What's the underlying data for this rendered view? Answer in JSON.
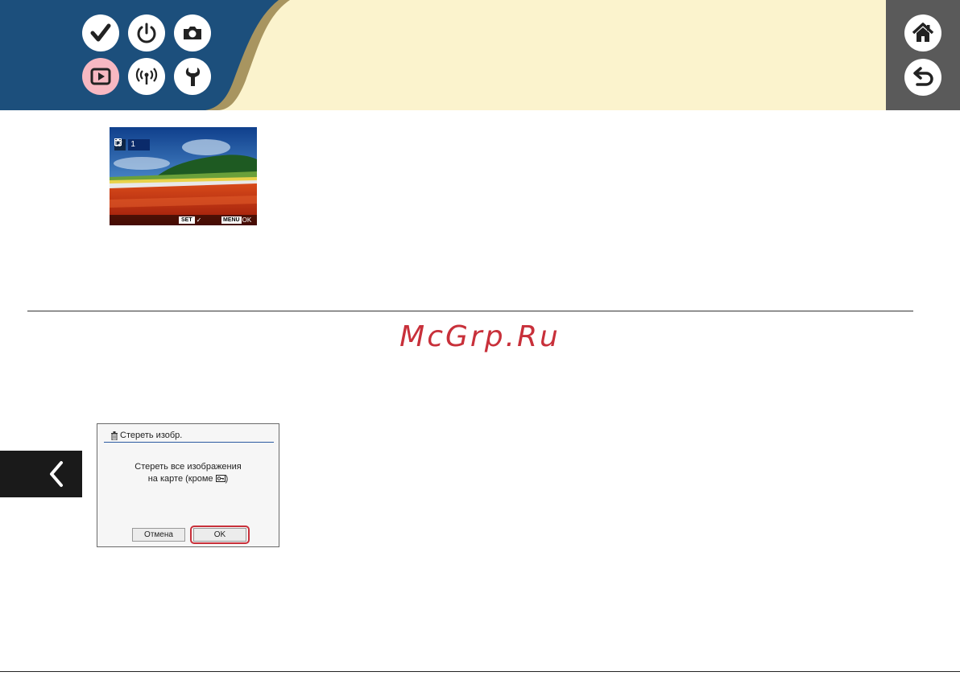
{
  "header": {
    "colors": {
      "dark_blue": "#1c4f7c",
      "gold_band": "#a89560",
      "cream": "#fbf3cd",
      "gray_sidebar": "#5a5a5a"
    },
    "nav_icons": [
      "checkmark-icon",
      "power-icon",
      "camera-icon",
      "playback-icon",
      "wireless-icon",
      "wrench-icon"
    ],
    "active_nav": "playback-icon",
    "side_icons": [
      "home-icon",
      "return-icon"
    ]
  },
  "preview": {
    "counter": "1",
    "set_key": "SET",
    "menu_key": "MENU",
    "menu_value": "OK"
  },
  "watermark": "McGrp.Ru",
  "dialog": {
    "title": "Стереть изобр.",
    "message_line1": "Стереть все изображения",
    "message_line2": "на карте (кроме",
    "message_line2_end": ")",
    "cancel_label": "Отмена",
    "ok_label": "OK",
    "highlight_color": "#c8303a"
  }
}
